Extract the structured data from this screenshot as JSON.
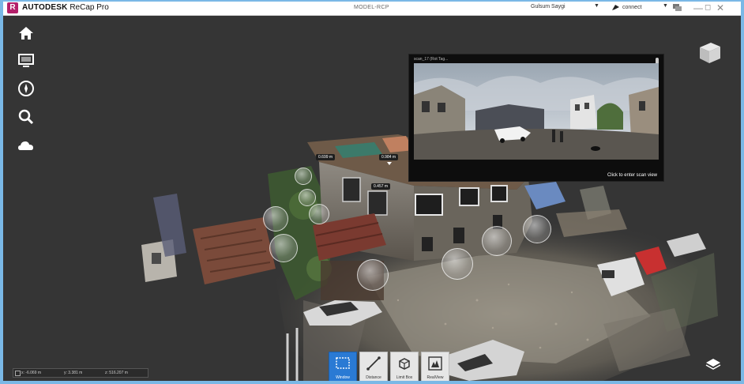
{
  "titlebar": {
    "logo_letter": "R",
    "app_brand": "AUTODESK",
    "app_product": "ReCap Pro",
    "document_title": "MODEL-RCP",
    "user_name": "Gulsum Saygi",
    "connect_label": "connect",
    "minimize_glyph": "—",
    "restore_glyph": "◻",
    "close_glyph": "✕"
  },
  "left_toolbar": {
    "items": [
      {
        "name": "home-icon"
      },
      {
        "name": "display-settings-icon"
      },
      {
        "name": "navigation-compass-icon"
      },
      {
        "name": "search-icon"
      },
      {
        "name": "cloud-icon"
      }
    ]
  },
  "scan_view": {
    "label": "scan_17 (Rot Tag...",
    "enter_label": "Click to enter scan view"
  },
  "measurements": [
    {
      "label": "0.699 m"
    },
    {
      "label": "0.984 m"
    },
    {
      "label": "0.457 m"
    }
  ],
  "bottom_toolbar": {
    "tools": [
      {
        "label": "Window",
        "active": true
      },
      {
        "label": "Distance",
        "active": false
      },
      {
        "label": "Limit Box",
        "active": false
      },
      {
        "label": "RealView",
        "active": false
      }
    ]
  },
  "coordinates": {
    "x": "x: -6.069 m",
    "y": "y: 3.381 m",
    "z": "z: 516.207 m"
  },
  "colors": {
    "accent": "#2a7ad4",
    "brand": "#b3206a",
    "viewport_bg": "#353535"
  }
}
